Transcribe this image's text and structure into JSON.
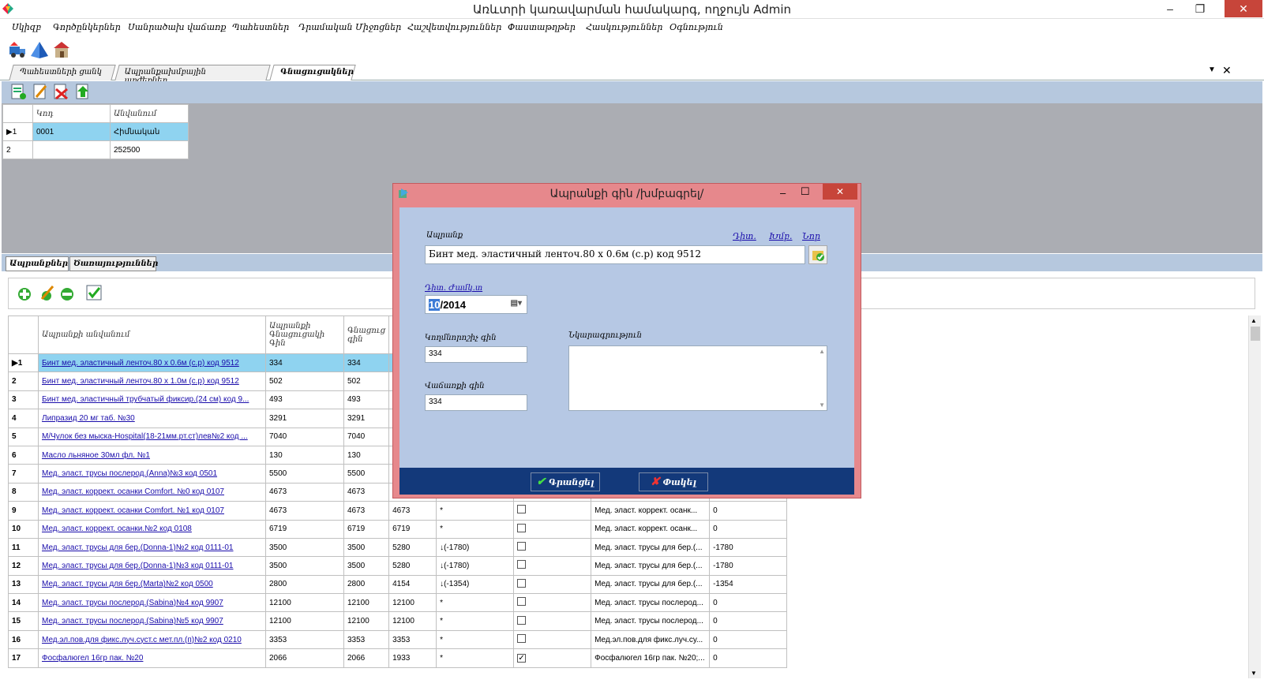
{
  "window": {
    "title": "Առևտրի կառավարման համակարգ, ողջույն Admin",
    "min": "–",
    "max": "❐",
    "close": "✕"
  },
  "menu": [
    "Սկիզբ",
    "Գործընկերներ",
    "Սանրածախ վաճառք",
    "Պահեստներ",
    "Դրամական Միջոցներ",
    "Հաշվետվություններ",
    "Փաստաթղթեր",
    "Հասկություններ",
    "Օգնություն"
  ],
  "doc_tabs": [
    "Պահեստների ցանկ",
    "Ապրանքախմբային արժեքներ...",
    "Գնացուցակներ"
  ],
  "upper_grid": {
    "headers": [
      "Կոդ",
      "Անվանում"
    ],
    "rows": [
      {
        "idx": "1",
        "code": "0001",
        "name": "Հիմնական"
      },
      {
        "idx": "2",
        "code": "",
        "name": "252500"
      }
    ]
  },
  "lower_tabs": [
    "Ապրանքներ",
    "Ծառայություններ"
  ],
  "main_grid": {
    "headers": [
      "Ապրանքի անվանում",
      "Ապրանքի Գնացուցակի Գին",
      "Գնացուց գին"
    ],
    "rows": [
      [
        "1",
        "Бинт мед. эластичный ленточ.80 х 0.6м (с.р) код 9512",
        "334",
        "334",
        "",
        "",
        false,
        "",
        ""
      ],
      [
        "2",
        "Бинт мед. эластичный ленточ.80 х 1.0м (с.р) код 9512",
        "502",
        "502",
        "",
        "",
        false,
        "",
        ""
      ],
      [
        "3",
        "Бинт мед. эластичный трубчатый фиксир.(24 см) код 9...",
        "493",
        "493",
        "",
        "",
        false,
        "",
        ""
      ],
      [
        "4",
        "Липразид 20 мг таб. №30",
        "3291",
        "3291",
        "",
        "",
        false,
        "",
        ""
      ],
      [
        "5",
        "М/Чулок без мыска-Hospital(18-21мм.рт.ст)лев№2 код ...",
        "7040",
        "7040",
        "",
        "",
        false,
        "",
        ""
      ],
      [
        "6",
        "Масло льняное 30мл фл. №1",
        "130",
        "130",
        "",
        "",
        false,
        "",
        ""
      ],
      [
        "7",
        "Мед. эласт. трусы послерод.(Anna)№3 код 0501",
        "5500",
        "5500",
        "",
        "",
        false,
        "",
        ""
      ],
      [
        "8",
        "Мед. эласт. коррект. осанки Comfort. №0 код 0107",
        "4673",
        "4673",
        "",
        "",
        false,
        "",
        ""
      ],
      [
        "9",
        "Мед. эласт. коррект. осанки Comfort. №1 код 0107",
        "4673",
        "4673",
        "4673",
        "*",
        false,
        "Мед. эласт. коррект. осанк...",
        "0"
      ],
      [
        "10",
        "Мед. эласт. коррект. осанки.№2 код 0108",
        "6719",
        "6719",
        "6719",
        "*",
        false,
        "Мед. эласт. коррект. осанк...",
        "0"
      ],
      [
        "11",
        "Мед. эласт. трусы для бер.(Donna-1)№2 код 0111-01",
        "3500",
        "3500",
        "5280",
        "↓(-1780)",
        false,
        "Мед. эласт. трусы для бер.(...",
        "-1780"
      ],
      [
        "12",
        "Мед. эласт. трусы для бер.(Donna-1)№3 код 0111-01",
        "3500",
        "3500",
        "5280",
        "↓(-1780)",
        false,
        "Мед. эласт. трусы для бер.(...",
        "-1780"
      ],
      [
        "13",
        "Мед. эласт. трусы для бер.(Marta)№2 код 0500",
        "2800",
        "2800",
        "4154",
        "↓(-1354)",
        false,
        "Мед. эласт. трусы для бер.(...",
        "-1354"
      ],
      [
        "14",
        "Мед. эласт. трусы послерод.(Sabina)№4 код 9907",
        "12100",
        "12100",
        "12100",
        "*",
        false,
        "Мед. эласт. трусы послерод...",
        "0"
      ],
      [
        "15",
        "Мед. эласт. трусы послерод.(Sabina)№5 код 9907",
        "12100",
        "12100",
        "12100",
        "*",
        false,
        "Мед. эласт. трусы послерод...",
        "0"
      ],
      [
        "16",
        "Мед.эл.пов.для фикс.луч.суст.с мет.пл.(п)№2 код 0210",
        "3353",
        "3353",
        "3353",
        "*",
        false,
        "Мед.эл.пов.для фикс.луч.су...",
        "0"
      ],
      [
        "17",
        "Фосфалюгел 16гр пак. №20",
        "2066",
        "2066",
        "1933",
        "*",
        true,
        "Фосфалюгел 16гр пак. №20;...",
        "0"
      ]
    ]
  },
  "dialog": {
    "title": "Ապրանքի գին /խմբագրել/",
    "min": "–",
    "max": "☐",
    "close": "✕",
    "product_label": "Ապրանք",
    "links": [
      "Դիտ.",
      "Խմբ.",
      "Նոր"
    ],
    "product_value": "Бинт мед. эластичный ленточ.80 х 0.6м (с.р) код 9512",
    "date_label": "Դիտ. Ժամկ.տ",
    "date_month": "10",
    "date_rest": "/2014",
    "wholesale_label": "Կողմնորոշիչ գին",
    "wholesale_value": "334",
    "retail_label": "Վաճառքի գին",
    "retail_value": "334",
    "notes_label": "Նկարագրություն",
    "save_label": "Գրանցել",
    "cancel_label": "Փակել"
  }
}
